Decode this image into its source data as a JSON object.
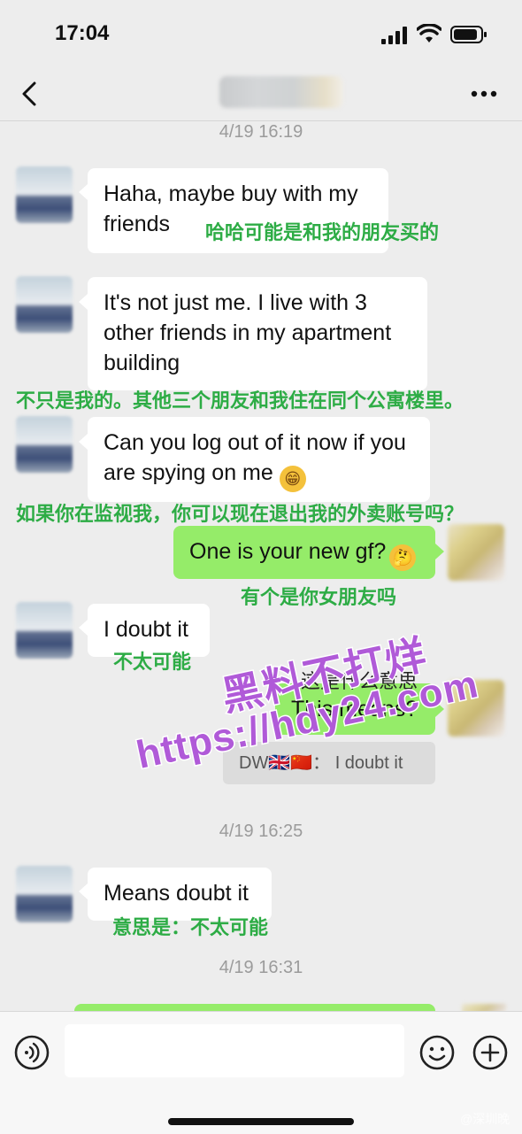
{
  "status_bar": {
    "time": "17:04"
  },
  "nav": {
    "back_icon": "chevron-left-icon",
    "more_icon": "more-dots-icon"
  },
  "timestamps": [
    "4/19 16:19",
    "4/19 16:25",
    "4/19 16:31"
  ],
  "messages": [
    {
      "side": "left",
      "text_line1": "Haha, maybe buy with my",
      "text_line2": "friends",
      "translation": "哈哈可能是和我的朋友买的"
    },
    {
      "side": "left",
      "text_line1": "It's not just me. I live with 3",
      "text_line2": "other friends in my apartment",
      "text_line3": "building",
      "translation": "不只是我的。其他三个朋友和我住在同个公寓楼里。"
    },
    {
      "side": "left",
      "text_line1": "Can you log out of it now if you",
      "text_line2": "are spying on me",
      "emoji": "😁",
      "translation": "如果你在监视我，你可以现在退出我的外卖账号吗？"
    },
    {
      "side": "right",
      "text": "One is your new gf?",
      "emoji": "🤔",
      "translation": "有个是你女朋友吗"
    },
    {
      "side": "left",
      "text": "I doubt it",
      "translation": "不太可能"
    },
    {
      "side": "right",
      "text": "This means?",
      "overlay_translation": "这是什么意思"
    },
    {
      "type": "quote",
      "author": "DW🇬🇧🇨🇳：",
      "text": "I doubt it"
    },
    {
      "side": "left",
      "text": "Means doubt it",
      "translation": "意思是：不太可能"
    }
  ],
  "watermark": {
    "line1": "黑料不打烊",
    "line2": "https://hdy24.com"
  },
  "input_bar": {
    "voice_icon": "voice-icon",
    "emoji_icon": "emoji-icon",
    "add_icon": "plus-icon"
  },
  "credit": "@深圳晚"
}
